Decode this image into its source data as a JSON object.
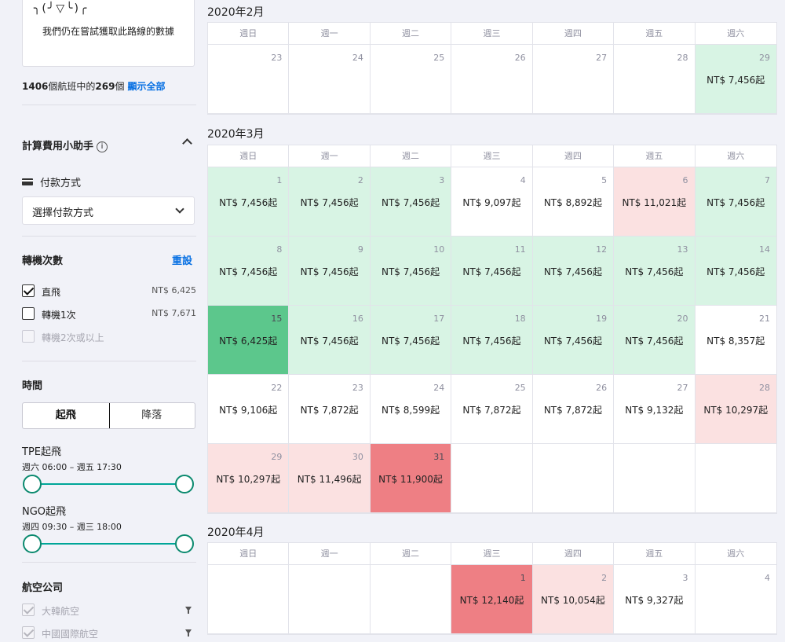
{
  "sidebar": {
    "loading_face": "╮(╯▽╰)╭",
    "loading_text": "我們仍在嘗試獲取此路線的數據",
    "count_total": "1406",
    "count_text_a": "個航班中的",
    "count_shown": "269",
    "count_text_b": "個",
    "show_all": "顯示全部",
    "calc_title": "計算費用小助手",
    "info_glyph": "i",
    "payment_label": "付款方式",
    "payment_select": "選擇付款方式",
    "stops_title": "轉機次數",
    "reset": "重設",
    "stops": [
      {
        "label": "直飛",
        "price": "NT$ 6,425"
      },
      {
        "label": "轉機1次",
        "price": "NT$ 7,671"
      },
      {
        "label": "轉機2次或以上",
        "price": ""
      }
    ],
    "time_title": "時間",
    "time_tabs": [
      "起飛",
      "降落"
    ],
    "tpe_title": "TPE起飛",
    "tpe_range": "週六 06:00 – 週五 17:30",
    "ngo_title": "NGO起飛",
    "ngo_range": "週四 09:30 – 週三 18:00",
    "airlines_title": "航空公司",
    "airlines": [
      "大韓航空",
      "中國國際航空"
    ]
  },
  "weekdays": [
    "週日",
    "週一",
    "週二",
    "週三",
    "週四",
    "週五",
    "週六"
  ],
  "months": [
    {
      "title": "2020年2月",
      "weeks": [
        [
          {
            "d": "23",
            "p": "",
            "s": ""
          },
          {
            "d": "24",
            "p": "",
            "s": ""
          },
          {
            "d": "25",
            "p": "",
            "s": ""
          },
          {
            "d": "26",
            "p": "",
            "s": ""
          },
          {
            "d": "27",
            "p": "",
            "s": ""
          },
          {
            "d": "28",
            "p": "",
            "s": ""
          },
          {
            "d": "29",
            "p": "NT$ 7,456起",
            "s": "green"
          }
        ]
      ]
    },
    {
      "title": "2020年3月",
      "weeks": [
        [
          {
            "d": "1",
            "p": "NT$ 7,456起",
            "s": "green"
          },
          {
            "d": "2",
            "p": "NT$ 7,456起",
            "s": "green"
          },
          {
            "d": "3",
            "p": "NT$ 7,456起",
            "s": "green"
          },
          {
            "d": "4",
            "p": "NT$ 9,097起",
            "s": ""
          },
          {
            "d": "5",
            "p": "NT$ 8,892起",
            "s": ""
          },
          {
            "d": "6",
            "p": "NT$ 11,021起",
            "s": "pink"
          },
          {
            "d": "7",
            "p": "NT$ 7,456起",
            "s": "green"
          }
        ],
        [
          {
            "d": "8",
            "p": "NT$ 7,456起",
            "s": "green"
          },
          {
            "d": "9",
            "p": "NT$ 7,456起",
            "s": "green"
          },
          {
            "d": "10",
            "p": "NT$ 7,456起",
            "s": "green"
          },
          {
            "d": "11",
            "p": "NT$ 7,456起",
            "s": "green"
          },
          {
            "d": "12",
            "p": "NT$ 7,456起",
            "s": "green"
          },
          {
            "d": "13",
            "p": "NT$ 7,456起",
            "s": "green"
          },
          {
            "d": "14",
            "p": "NT$ 7,456起",
            "s": "green"
          }
        ],
        [
          {
            "d": "15",
            "p": "NT$ 6,425起",
            "s": "green-dark"
          },
          {
            "d": "16",
            "p": "NT$ 7,456起",
            "s": "green"
          },
          {
            "d": "17",
            "p": "NT$ 7,456起",
            "s": "green"
          },
          {
            "d": "18",
            "p": "NT$ 7,456起",
            "s": "green"
          },
          {
            "d": "19",
            "p": "NT$ 7,456起",
            "s": "green"
          },
          {
            "d": "20",
            "p": "NT$ 7,456起",
            "s": "green"
          },
          {
            "d": "21",
            "p": "NT$ 8,357起",
            "s": ""
          }
        ],
        [
          {
            "d": "22",
            "p": "NT$ 9,106起",
            "s": ""
          },
          {
            "d": "23",
            "p": "NT$ 7,872起",
            "s": ""
          },
          {
            "d": "24",
            "p": "NT$ 8,599起",
            "s": ""
          },
          {
            "d": "25",
            "p": "NT$ 7,872起",
            "s": ""
          },
          {
            "d": "26",
            "p": "NT$ 7,872起",
            "s": ""
          },
          {
            "d": "27",
            "p": "NT$ 9,132起",
            "s": ""
          },
          {
            "d": "28",
            "p": "NT$ 10,297起",
            "s": "pink"
          }
        ],
        [
          {
            "d": "29",
            "p": "NT$ 10,297起",
            "s": "pink"
          },
          {
            "d": "30",
            "p": "NT$ 11,496起",
            "s": "pink"
          },
          {
            "d": "31",
            "p": "NT$ 11,900起",
            "s": "red"
          },
          {
            "d": "",
            "p": "",
            "s": "empty"
          },
          {
            "d": "",
            "p": "",
            "s": "empty"
          },
          {
            "d": "",
            "p": "",
            "s": "empty"
          },
          {
            "d": "",
            "p": "",
            "s": "empty"
          }
        ]
      ]
    },
    {
      "title": "2020年4月",
      "weeks": [
        [
          {
            "d": "",
            "p": "",
            "s": "empty"
          },
          {
            "d": "",
            "p": "",
            "s": "empty"
          },
          {
            "d": "",
            "p": "",
            "s": "empty"
          },
          {
            "d": "1",
            "p": "NT$ 12,140起",
            "s": "red"
          },
          {
            "d": "2",
            "p": "NT$ 10,054起",
            "s": "pink"
          },
          {
            "d": "3",
            "p": "NT$ 9,327起",
            "s": ""
          },
          {
            "d": "4",
            "p": "",
            "s": ""
          }
        ]
      ]
    }
  ],
  "colors": {
    "cheap": "#d8f4e4",
    "cheapest": "#5cc78c",
    "expensive": "#fbe1e1",
    "most_expensive": "#ee7f84",
    "link": "#0770e3",
    "slider": "#00a698"
  },
  "icons": [
    "info-icon",
    "chevron-up-icon",
    "card-icon",
    "chevron-down-icon",
    "checkbox-icon",
    "filter-icon"
  ]
}
